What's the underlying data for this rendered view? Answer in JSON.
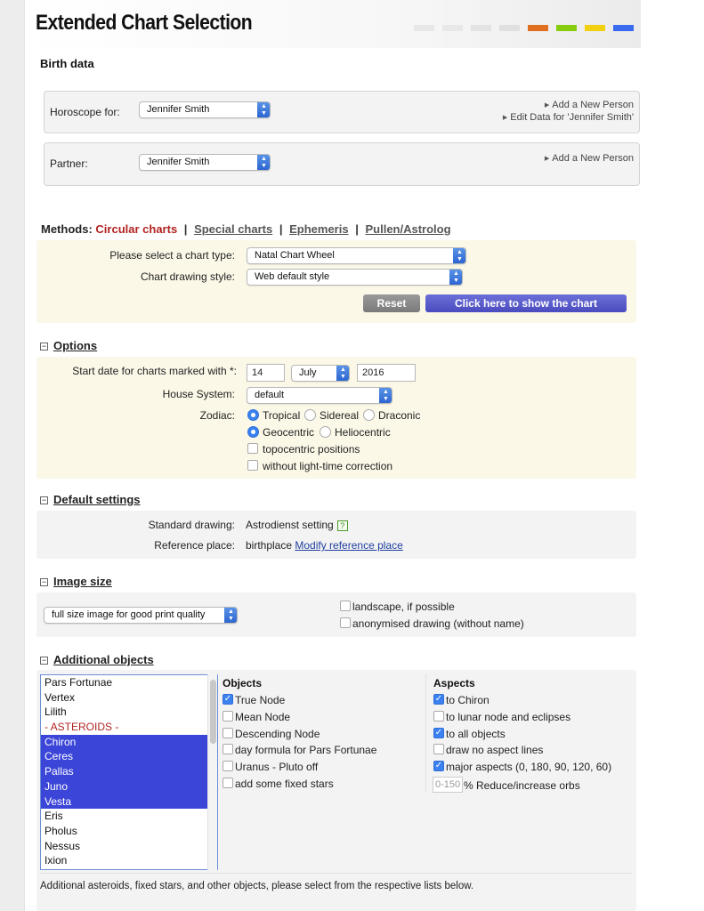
{
  "page": {
    "title": "Extended Chart Selection",
    "swatch_colors": [
      "#e8e8e8",
      "#e8e8e8",
      "#e3e3e3",
      "#e0e0e0",
      "#e07020",
      "#88cc10",
      "#f0d010",
      "#3a6af0"
    ]
  },
  "birth_data": {
    "heading": "Birth data",
    "horoscope_label": "Horoscope for:",
    "horoscope_value": "Jennifer Smith",
    "add_new_person": "Add a New Person",
    "edit_data": "Edit Data for 'Jennifer Smith'",
    "partner_label": "Partner:",
    "partner_value": "Jennifer Smith",
    "partner_add_new": "Add a New Person"
  },
  "methods": {
    "label": "Methods:",
    "active": "Circular charts",
    "tabs": [
      "Special charts",
      "Ephemeris",
      "Pullen/Astrolog"
    ],
    "separator": "|"
  },
  "chart_select": {
    "type_label": "Please select a chart type:",
    "type_value": "Natal Chart Wheel",
    "style_label": "Chart drawing style:",
    "style_value": "Web default style",
    "reset_label": "Reset",
    "show_label": "Click here to show the chart"
  },
  "options": {
    "heading": "Options",
    "start_date_label": "Start date for charts marked with *:",
    "day": "14",
    "month": "July",
    "year": "2016",
    "house_label": "House System:",
    "house_value": "default",
    "zodiac_label": "Zodiac:",
    "tropical": "Tropical",
    "sidereal": "Sidereal",
    "draconic": "Draconic",
    "geocentric": "Geocentric",
    "heliocentric": "Heliocentric",
    "topocentric": "topocentric positions",
    "light_time": "without light-time correction"
  },
  "default_settings": {
    "heading": "Default settings",
    "standard_label": "Standard drawing:",
    "standard_value": "Astrodienst setting",
    "help_glyph": "?",
    "reference_label": "Reference place:",
    "reference_value": "birthplace",
    "modify_link": "Modify reference place"
  },
  "image_size": {
    "heading": "Image size",
    "size_value": "full size image for good print quality",
    "landscape": "landscape, if possible",
    "anonymised": "anonymised drawing (without name)"
  },
  "additional_objects": {
    "heading": "Additional objects",
    "list": [
      {
        "label": "Pars Fortunae",
        "selected": false
      },
      {
        "label": "Vertex",
        "selected": false
      },
      {
        "label": "Lilith",
        "selected": false
      },
      {
        "label": "- ASTEROIDS -",
        "selected": false
      },
      {
        "label": "Chiron",
        "selected": true
      },
      {
        "label": "Ceres",
        "selected": true
      },
      {
        "label": "Pallas",
        "selected": true
      },
      {
        "label": "Juno",
        "selected": true
      },
      {
        "label": "Vesta",
        "selected": true
      },
      {
        "label": "Eris",
        "selected": false
      },
      {
        "label": "Pholus",
        "selected": false
      },
      {
        "label": "Nessus",
        "selected": false
      },
      {
        "label": "Ixion",
        "selected": false
      }
    ],
    "objects_heading": "Objects",
    "objects": [
      {
        "label": "True Node",
        "checked": true
      },
      {
        "label": "Mean Node",
        "checked": false
      },
      {
        "label": "Descending Node",
        "checked": false
      },
      {
        "label": "day formula for Pars Fortunae",
        "checked": false
      },
      {
        "label": "Uranus - Pluto off",
        "checked": false
      },
      {
        "label": "add some fixed stars",
        "checked": false
      }
    ],
    "aspects_heading": "Aspects",
    "aspects": [
      {
        "label": "to Chiron",
        "checked": true
      },
      {
        "label": "to lunar node and eclipses",
        "checked": false
      },
      {
        "label": "to all objects",
        "checked": true
      },
      {
        "label": "draw no aspect lines",
        "checked": false
      },
      {
        "label": "major aspects (0, 180, 90, 120, 60)",
        "checked": true
      }
    ],
    "orb_placeholder": "0-150",
    "orb_label": "% Reduce/increase orbs",
    "footer_note": "Additional asteroids, fixed stars, and other objects, please select from the respective lists below."
  }
}
